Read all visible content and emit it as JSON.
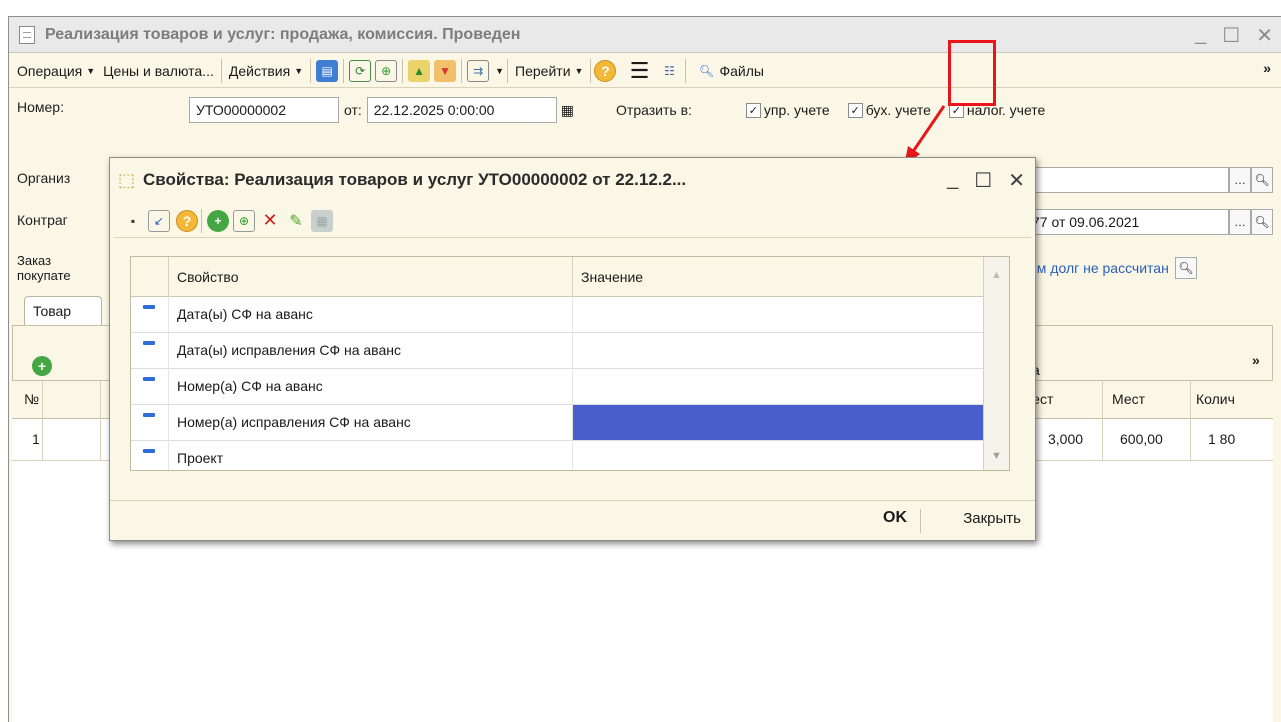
{
  "main_window": {
    "title": "Реализация товаров и услуг: продажа, комиссия. Проведен",
    "window_controls": {
      "minimize": "_",
      "maximize": "☐",
      "close": "✕"
    },
    "toolbar": {
      "operation": "Операция",
      "prices_currency": "Цены и валюта...",
      "actions": "Действия",
      "go_to": "Перейти",
      "files": "Файлы",
      "more": "»"
    },
    "form": {
      "number_label": "Номер:",
      "number_value": "УТО00000002",
      "from_label": "от:",
      "date_value": "22.12.2025  0:00:00",
      "reflect_label": "Отразить в:",
      "check_mgmt": "упр. учете",
      "check_acct": "бух. учете",
      "check_tax": "налог. учете",
      "organization_label": "Организ",
      "counterparty_label": "Контраг",
      "contract_value": "77 от 09.06.2021",
      "order_label_1": "Заказ",
      "order_label_2": "покупате",
      "debt_text": "ем долг не рассчитан"
    },
    "tab_label": "Товар",
    "grid": {
      "col_no": "№",
      "col_a": "а",
      "col_mest_short": "лест",
      "col_mest": "Мест",
      "col_qty": "Колич",
      "row1_no": "1",
      "row1_a": "3,000",
      "row1_mest": "600,00",
      "row1_qty": "1 80"
    }
  },
  "dialog": {
    "title": "Свойства: Реализация товаров и услуг УТО00000002 от 22.12.2...",
    "columns": {
      "property": "Свойство",
      "value": "Значение"
    },
    "rows": [
      {
        "property": "Дата(ы)  СФ на аванс",
        "value": ""
      },
      {
        "property": "Дата(ы) исправления СФ на аванс",
        "value": ""
      },
      {
        "property": "Номер(а)  СФ на аванс",
        "value": ""
      },
      {
        "property": "Номер(а) исправления СФ на аванс",
        "value": ""
      },
      {
        "property": "Проект",
        "value": ""
      }
    ],
    "ok_label": "OK",
    "close_label": "Закрыть"
  },
  "colors": {
    "highlight": "#e8161b",
    "selected_cell": "#4a5fcc",
    "panel_bg": "#fbf7e6"
  }
}
